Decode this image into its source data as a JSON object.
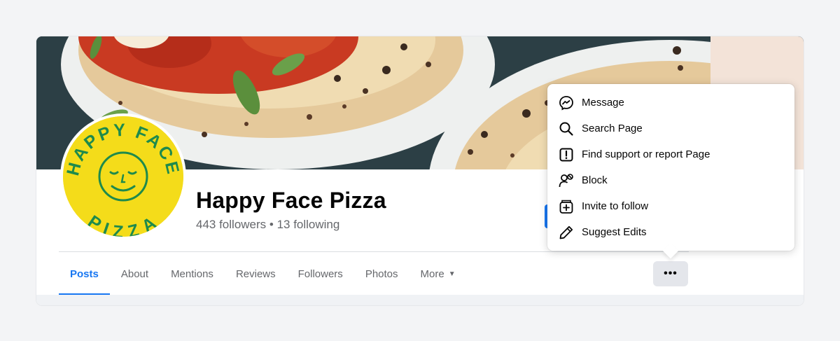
{
  "page": {
    "name": "Happy Face Pizza",
    "stats": "443 followers • 13 following"
  },
  "logo": {
    "line_top": "HAPPY FACE",
    "line_bottom": "PIZZA"
  },
  "tabs": [
    {
      "label": "Posts",
      "active": true
    },
    {
      "label": "About"
    },
    {
      "label": "Mentions"
    },
    {
      "label": "Reviews"
    },
    {
      "label": "Followers"
    },
    {
      "label": "Photos"
    },
    {
      "label": "More",
      "icon": "caret-down-icon"
    }
  ],
  "more_button": {
    "label": "•••"
  },
  "menu": {
    "items": [
      {
        "label": "Message",
        "icon": "messenger-icon"
      },
      {
        "label": "Search Page",
        "icon": "search-icon"
      },
      {
        "label": "Find support or report Page",
        "icon": "report-icon"
      },
      {
        "label": "Block",
        "icon": "block-user-icon"
      },
      {
        "label": "Invite to follow",
        "icon": "invite-icon"
      },
      {
        "label": "Suggest Edits",
        "icon": "pencil-icon"
      }
    ]
  },
  "colors": {
    "accent": "#1877f2",
    "logo_yellow": "#f4dc1a",
    "logo_green": "#1e8a4c"
  }
}
